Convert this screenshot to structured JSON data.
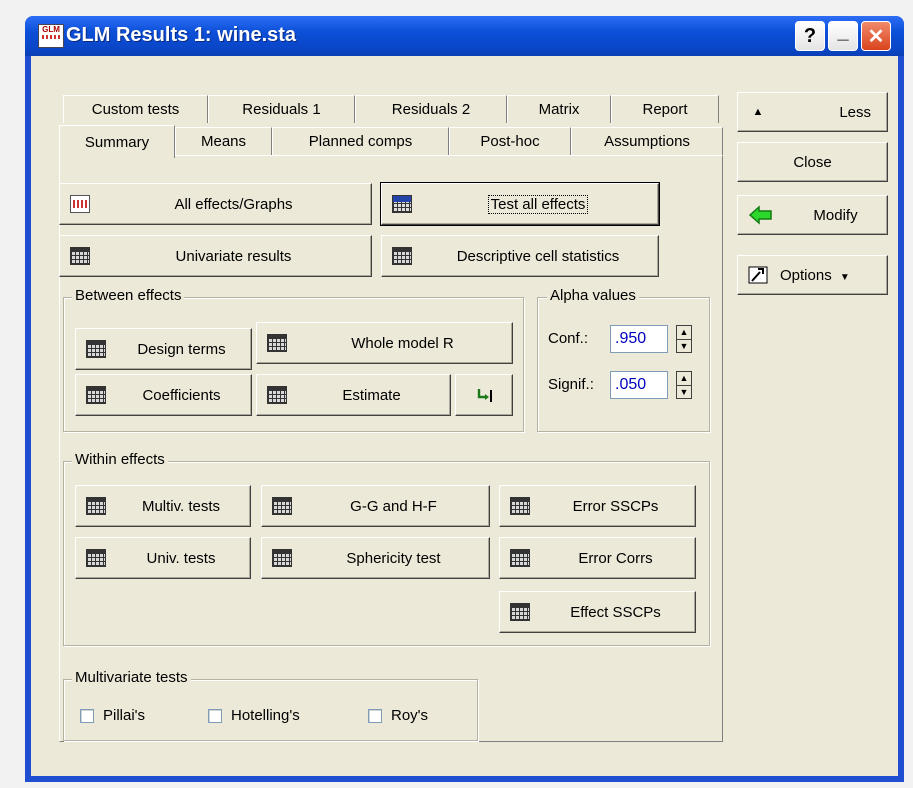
{
  "window": {
    "title": "GLM Results 1: wine.sta",
    "icon": "glm-app-icon",
    "help_label": "?",
    "minimize_label": "_",
    "close_label": "✕"
  },
  "tabs": {
    "row_back": [
      "Custom tests",
      "Residuals 1",
      "Residuals 2",
      "Matrix",
      "Report"
    ],
    "row_front": [
      "Summary",
      "Means",
      "Planned comps",
      "Post-hoc",
      "Assumptions"
    ],
    "active": "Summary"
  },
  "summary": {
    "all_effects_graphs": "All effects/Graphs",
    "test_all_effects": "Test all effects",
    "univariate_results": "Univariate results",
    "descriptive_cell_statistics": "Descriptive cell statistics"
  },
  "between": {
    "title": "Between effects",
    "design_terms": "Design terms",
    "whole_model_r": "Whole model R",
    "coefficients": "Coefficients",
    "estimate": "Estimate"
  },
  "alpha": {
    "title": "Alpha values",
    "conf_label": "Conf.:",
    "conf_value": ".950",
    "signif_label": "Signif.:",
    "signif_value": ".050"
  },
  "within": {
    "title": "Within effects",
    "multiv_tests": "Multiv. tests",
    "gg_hf": "G-G and H-F",
    "error_sscps": "Error SSCPs",
    "univ_tests": "Univ. tests",
    "sphericity_test": "Sphericity test",
    "error_corrs": "Error Corrs",
    "effect_sscps": "Effect SSCPs"
  },
  "multivariate": {
    "title": "Multivariate tests",
    "options": [
      {
        "label": "Pillai's",
        "checked": false
      },
      {
        "label": "Hotelling's",
        "checked": false
      },
      {
        "label": "Roy's",
        "checked": false
      }
    ]
  },
  "side": {
    "less": "Less",
    "close": "Close",
    "modify": "Modify",
    "options": "Options"
  },
  "colors": {
    "titlebar": "#0a46c8",
    "value_text": "#0000c0",
    "face": "#ece9d8"
  }
}
